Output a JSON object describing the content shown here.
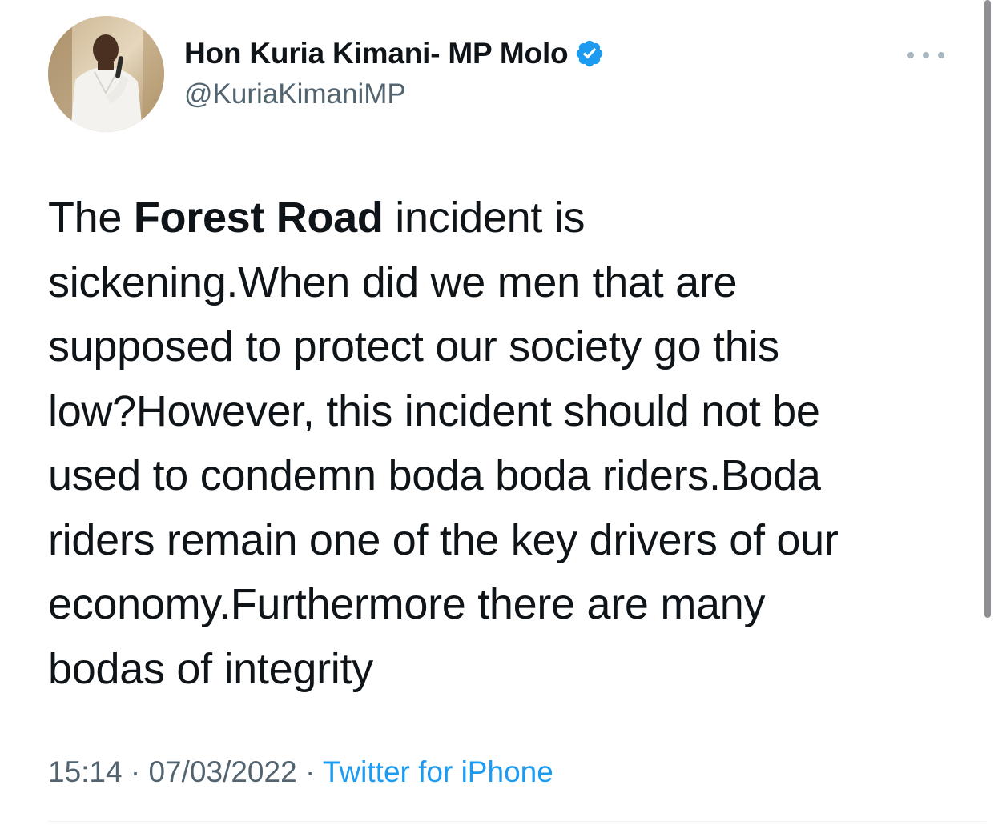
{
  "author": {
    "display_name": "Hon Kuria Kimani- MP Molo",
    "handle": "@KuriaKimaniMP",
    "verified": true,
    "avatar_icon": "profile-photo"
  },
  "tweet": {
    "lines": [
      {
        "pre": "The ",
        "bold": "Forest Road",
        "post": " incident is"
      },
      {
        "text": "sickening.When did we men that are"
      },
      {
        "text": "supposed to protect our society go this"
      },
      {
        "text": "low?However, this incident should not be"
      },
      {
        "text": "used to condemn boda boda riders.Boda"
      },
      {
        "text": "riders remain one of the key drivers of our"
      },
      {
        "text": "economy.Furthermore there are many"
      },
      {
        "text": "bodas of integrity"
      }
    ]
  },
  "meta": {
    "time": "15:14",
    "separator": " · ",
    "date": "07/03/2022",
    "source": "Twitter for iPhone"
  },
  "colors": {
    "text": "#0f1419",
    "secondary": "#536471",
    "accent": "#1d9bf0"
  },
  "icons": {
    "verified": "verified-badge-icon",
    "more": "more-options-icon"
  }
}
